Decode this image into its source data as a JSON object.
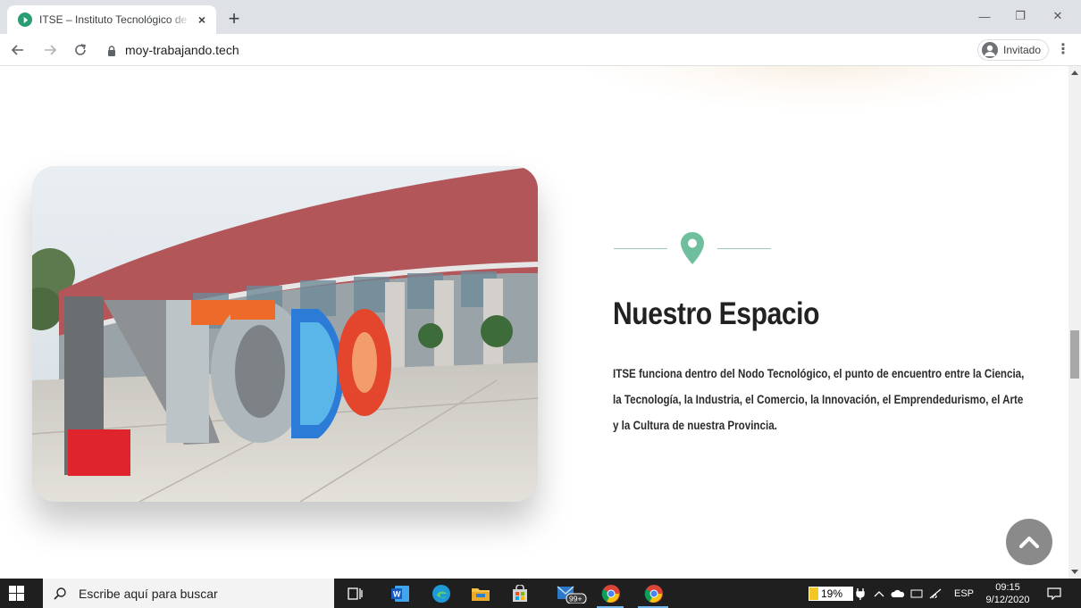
{
  "browser": {
    "tab_title": "ITSE – Instituto Tecnológico de Santiago del Estero",
    "tab_close": "×",
    "new_tab": "+",
    "url": "moy-trabajando.tech",
    "profile_label": "Invitado",
    "window_controls": {
      "minimize": "—",
      "restore": "❐",
      "close": "✕"
    }
  },
  "page": {
    "section_title": "Nuestro Espacio",
    "section_body": "ITSE funciona dentro del Nodo Tecnológico, el punto de encuentro entre la Ciencia, la Tecnología, la Industria, el Comercio, la Innovación, el Emprendedurismo, el Arte y la Cultura de nuestra Provincia.",
    "photo_description_icon": "nodo-sculpture-photo",
    "accent_color": "#6fbf9e"
  },
  "taskbar": {
    "search_placeholder": "Escribe aquí para buscar",
    "store_badge": "99+",
    "battery_percent": "19%",
    "language": "ESP",
    "time": "09:15",
    "date": "9/12/2020"
  }
}
